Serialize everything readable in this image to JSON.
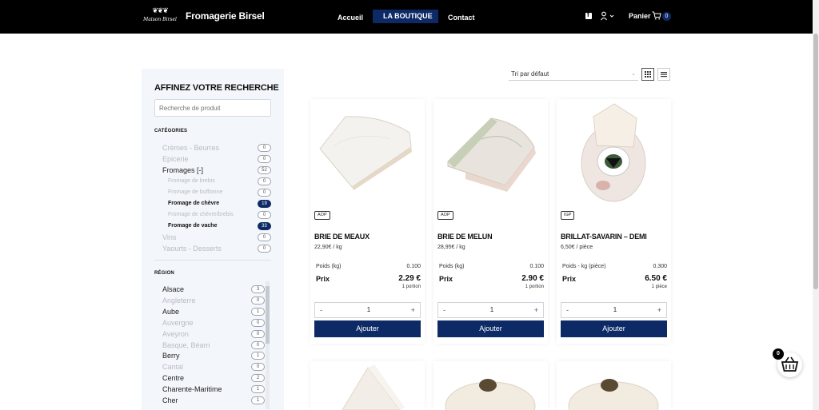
{
  "header": {
    "logo_text": "Maison Birsel",
    "brand": "Fromagerie Birsel",
    "nav": [
      {
        "label": "Accueil",
        "active": false
      },
      {
        "label": "LA BOUTIQUE",
        "active": true
      },
      {
        "label": "Contact",
        "active": false
      }
    ],
    "cart_label": "Panier",
    "cart_count": "0"
  },
  "sidebar": {
    "title": "AFFINEZ VOTRE RECHERCHE",
    "search_placeholder": "Recherche de produit",
    "categories_heading": "CATÉGORIES",
    "categories": [
      {
        "label": "Crèmes - Beurres",
        "count": "0",
        "state": "muted",
        "level": 0
      },
      {
        "label": "Epicerie",
        "count": "0",
        "state": "muted",
        "level": 0
      },
      {
        "label": "Fromages [-]",
        "count": "52",
        "state": "normal",
        "level": 0
      },
      {
        "label": "Fromage de brebis",
        "count": "0",
        "state": "muted",
        "level": 1
      },
      {
        "label": "Fromage de buffionne",
        "count": "0",
        "state": "muted",
        "level": 1
      },
      {
        "label": "Fromage de chèvre",
        "count": "19",
        "state": "strong",
        "level": 1
      },
      {
        "label": "Fromage de chèvre/brebis",
        "count": "0",
        "state": "muted",
        "level": 1
      },
      {
        "label": "Fromage de vache",
        "count": "33",
        "state": "strong",
        "level": 1
      },
      {
        "label": "Vins",
        "count": "0",
        "state": "muted",
        "level": 0
      },
      {
        "label": "Yaourts - Desserts",
        "count": "0",
        "state": "muted",
        "level": 0
      }
    ],
    "region_heading": "RÉGION",
    "regions": [
      {
        "label": "Alsace",
        "count": "3",
        "state": "normal"
      },
      {
        "label": "Angleterre",
        "count": "0",
        "state": "muted"
      },
      {
        "label": "Aube",
        "count": "1",
        "state": "normal"
      },
      {
        "label": "Auvergne",
        "count": "0",
        "state": "muted"
      },
      {
        "label": "Aveyron",
        "count": "0",
        "state": "muted"
      },
      {
        "label": "Basque, Béarn",
        "count": "0",
        "state": "muted"
      },
      {
        "label": "Berry",
        "count": "1",
        "state": "normal"
      },
      {
        "label": "Cantal",
        "count": "0",
        "state": "muted"
      },
      {
        "label": "Centre",
        "count": "2",
        "state": "normal"
      },
      {
        "label": "Charente-Maritime",
        "count": "1",
        "state": "normal"
      },
      {
        "label": "Cher",
        "count": "1",
        "state": "normal"
      }
    ]
  },
  "toolbar": {
    "sort_value": "Tri par défaut",
    "views": [
      "grid-view-icon",
      "list-view-icon"
    ]
  },
  "products": [
    {
      "badge": "AOP",
      "name": "BRIE DE MEAUX",
      "unit_price": "22,90€ / kg",
      "weight_label": "Poids (kg)",
      "weight_value": "0.100",
      "price_label": "Prix",
      "price": "2.29 €",
      "portion": "1 portion",
      "qty": "1",
      "add_label": "Ajouter",
      "minus": "-",
      "plus": "+"
    },
    {
      "badge": "AOP",
      "name": "BRIE DE MELUN",
      "unit_price": "28,95€ / kg",
      "weight_label": "Poids (kg)",
      "weight_value": "0.100",
      "price_label": "Prix",
      "price": "2.90 €",
      "portion": "1 portion",
      "qty": "1",
      "add_label": "Ajouter",
      "minus": "-",
      "plus": "+"
    },
    {
      "badge": "IGP",
      "name": "BRILLAT-SAVARIN – DEMI",
      "unit_price": "6,50€ / pièce",
      "weight_label": "Poids - kg (pièce)",
      "weight_value": "0.300",
      "price_label": "Prix",
      "price": "6.50 €",
      "portion": "1 pièce",
      "qty": "1",
      "add_label": "Ajouter",
      "minus": "-",
      "plus": "+"
    }
  ],
  "floating_cart": {
    "count": "0"
  },
  "colors": {
    "header_bg": "#000000",
    "brand_navy": "#0d2a66",
    "sidebar_bg": "#f3f6fa"
  }
}
